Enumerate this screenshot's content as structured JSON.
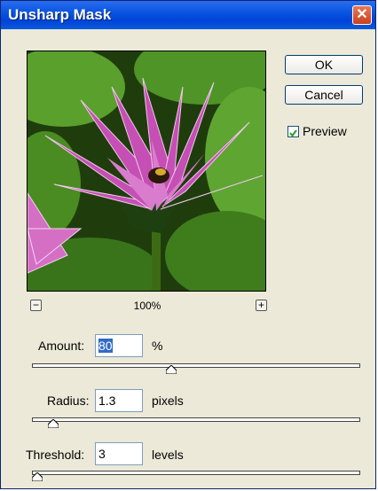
{
  "window": {
    "title": "Unsharp Mask",
    "close_glyph": "✕"
  },
  "buttons": {
    "ok": "OK",
    "cancel": "Cancel"
  },
  "preview_toggle": {
    "label": "Preview",
    "checked": true
  },
  "zoom": {
    "level": "100%",
    "zoom_out_glyph": "−",
    "zoom_in_glyph": "+"
  },
  "amount": {
    "label": "Amount:",
    "value": "80",
    "unit": "%",
    "slider_fraction": 0.42
  },
  "radius": {
    "label": "Radius:",
    "value": "1.3",
    "unit": "pixels",
    "slider_fraction": 0.06
  },
  "threshold": {
    "label": "Threshold:",
    "value": "3",
    "unit": "levels",
    "slider_fraction": 0.01
  },
  "icons": [
    "close-icon",
    "zoom-out-icon",
    "zoom-in-icon",
    "checkmark-icon"
  ],
  "colors": {
    "title_bar": "#0a55e0",
    "dialog_bg": "#ece9d8",
    "close_button": "#c9401c",
    "selection": "#316ac5"
  }
}
